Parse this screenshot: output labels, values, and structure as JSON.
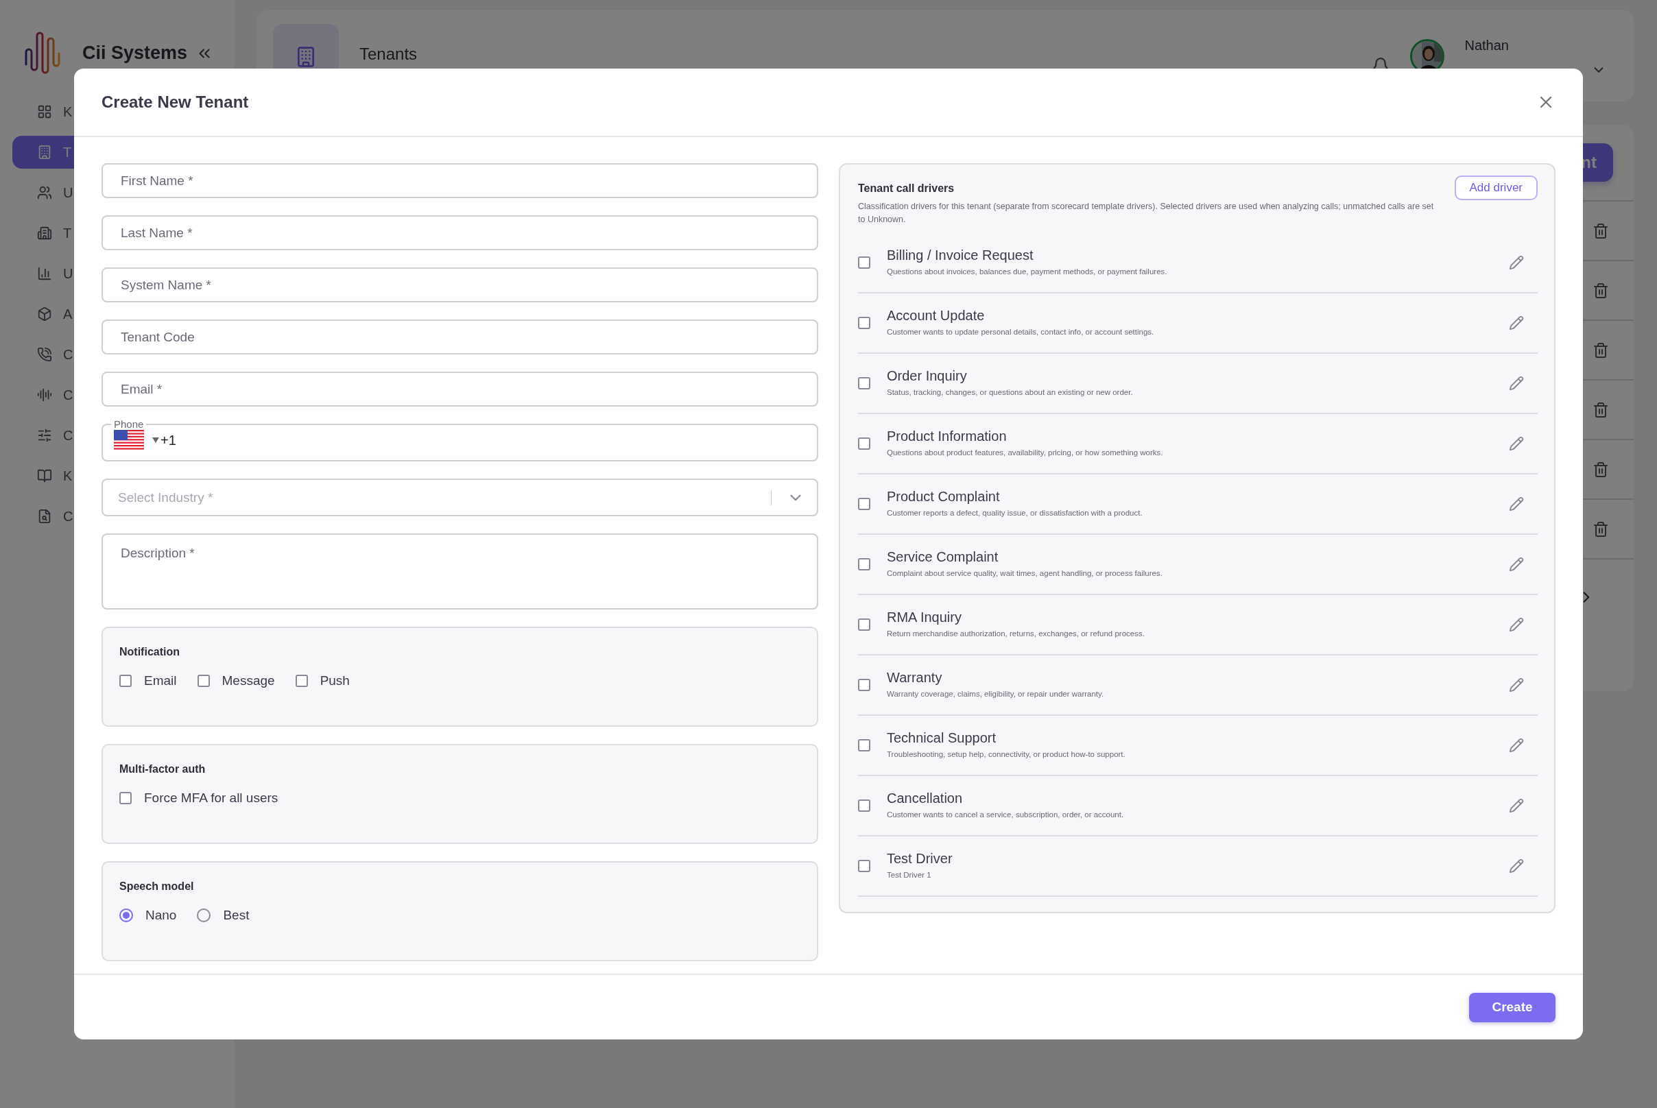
{
  "sidebar": {
    "brand": "Cii Systems",
    "items": [
      {
        "label": "K",
        "selected": false
      },
      {
        "label": "T",
        "selected": true
      },
      {
        "label": "U",
        "selected": false
      },
      {
        "label": "T",
        "selected": false
      },
      {
        "label": "U",
        "selected": false
      },
      {
        "label": "A",
        "selected": false
      },
      {
        "label": "C",
        "selected": false
      },
      {
        "label": "C",
        "selected": false
      },
      {
        "label": "C",
        "selected": false
      },
      {
        "label": "K",
        "selected": false
      },
      {
        "label": "C",
        "selected": false
      }
    ]
  },
  "header": {
    "title": "Tenants",
    "user": {
      "name": "Nathan"
    }
  },
  "content": {
    "button": "nt"
  },
  "modal": {
    "title": "Create New Tenant",
    "fields": [
      {
        "kind": "text",
        "placeholder": "First Name *"
      },
      {
        "kind": "text",
        "placeholder": "Last Name *"
      },
      {
        "kind": "text",
        "placeholder": "System Name *"
      },
      {
        "kind": "text",
        "placeholder": "Tenant Code"
      },
      {
        "kind": "text",
        "placeholder": "Email *"
      },
      {
        "kind": "phone",
        "label": "Phone",
        "value": "+1"
      },
      {
        "kind": "select",
        "placeholder": "Select Industry *"
      },
      {
        "kind": "textarea",
        "placeholder": "Description *"
      }
    ],
    "sections": [
      {
        "title": "Notification",
        "options": [
          {
            "kind": "checkbox",
            "label": "Email",
            "checked": false
          },
          {
            "kind": "checkbox",
            "label": "Message",
            "checked": false
          },
          {
            "kind": "checkbox",
            "label": "Push",
            "checked": false
          }
        ]
      },
      {
        "title": "Multi-factor auth",
        "options": [
          {
            "kind": "checkbox",
            "label": "Force MFA for all users",
            "checked": false
          }
        ]
      },
      {
        "title": "Speech model",
        "options": [
          {
            "kind": "radio",
            "label": "Nano",
            "selected": true
          },
          {
            "kind": "radio",
            "label": "Best",
            "selected": false
          }
        ]
      }
    ],
    "drivers": {
      "title": "Tenant call drivers",
      "description": "Classification drivers for this tenant (separate from scorecard template drivers). Selected drivers are used when analyzing calls; unmatched calls are set to Unknown.",
      "add_button": "Add driver",
      "items": [
        {
          "name": "Billing / Invoice Request",
          "description": "Questions about invoices, balances due, payment methods, or payment failures.",
          "checked": false
        },
        {
          "name": "Account Update",
          "description": "Customer wants to update personal details, contact info, or account settings.",
          "checked": false
        },
        {
          "name": "Order Inquiry",
          "description": "Status, tracking, changes, or questions about an existing or new order.",
          "checked": false
        },
        {
          "name": "Product Information",
          "description": "Questions about product features, availability, pricing, or how something works.",
          "checked": false
        },
        {
          "name": "Product Complaint",
          "description": "Customer reports a defect, quality issue, or dissatisfaction with a product.",
          "checked": false
        },
        {
          "name": "Service Complaint",
          "description": "Complaint about service quality, wait times, agent handling, or process failures.",
          "checked": false
        },
        {
          "name": "RMA Inquiry",
          "description": "Return merchandise authorization, returns, exchanges, or refund process.",
          "checked": false
        },
        {
          "name": "Warranty",
          "description": "Warranty coverage, claims, eligibility, or repair under warranty.",
          "checked": false
        },
        {
          "name": "Technical Support",
          "description": "Troubleshooting, setup help, connectivity, or product how-to support.",
          "checked": false
        },
        {
          "name": "Cancellation",
          "description": "Customer wants to cancel a service, subscription, order, or account.",
          "checked": false
        },
        {
          "name": "Test Driver",
          "description": "Test Driver 1",
          "checked": false
        }
      ]
    },
    "submit": "Create"
  }
}
